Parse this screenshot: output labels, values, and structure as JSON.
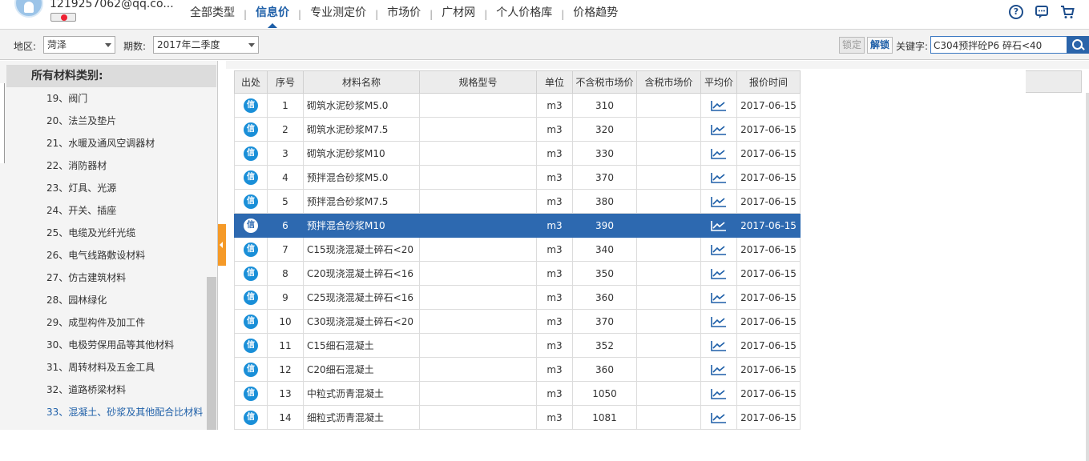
{
  "user": {
    "email": "1219257062@qq.co..."
  },
  "nav": {
    "items": [
      {
        "label": "全部类型"
      },
      {
        "label": "信息价"
      },
      {
        "label": "专业测定价"
      },
      {
        "label": "市场价"
      },
      {
        "label": "广材网"
      },
      {
        "label": "个人价格库"
      },
      {
        "label": "价格趋势"
      }
    ],
    "active_index": 1
  },
  "filters": {
    "region_label": "地区:",
    "region_value": "菏泽",
    "period_label": "期数:",
    "period_value": "2017年二季度",
    "lock_label": "锁定",
    "unlock_label": "解锁",
    "keyword_label": "关键字:",
    "keyword_value": "C304预拌砼P6 碎石<40"
  },
  "sidebar": {
    "title": "所有材料类别:",
    "items": [
      "19、阀门",
      "20、法兰及垫片",
      "21、水暖及通风空调器材",
      "22、消防器材",
      "23、灯具、光源",
      "24、开关、插座",
      "25、电缆及光纤光缆",
      "26、电气线路敷设材料",
      "27、仿古建筑材料",
      "28、园林绿化",
      "29、成型构件及加工件",
      "30、电极劳保用品等其他材料",
      "31、周转材料及五金工具",
      "32、道路桥梁材料",
      "33、混凝土、砂浆及其他配合比材料"
    ],
    "selected_index": 14
  },
  "table": {
    "columns": [
      "出处",
      "序号",
      "材料名称",
      "规格型号",
      "单位",
      "不含税市场价",
      "含税市场价",
      "平均价",
      "报价时间"
    ],
    "source_icon_text": "信",
    "selected_row": 5,
    "rows": [
      {
        "no": "1",
        "name": "砌筑水泥砂浆M5.0",
        "spec": "",
        "unit": "m3",
        "price": "310",
        "price_tax": "",
        "date": "2017-06-15"
      },
      {
        "no": "2",
        "name": "砌筑水泥砂浆M7.5",
        "spec": "",
        "unit": "m3",
        "price": "320",
        "price_tax": "",
        "date": "2017-06-15"
      },
      {
        "no": "3",
        "name": "砌筑水泥砂浆M10",
        "spec": "",
        "unit": "m3",
        "price": "330",
        "price_tax": "",
        "date": "2017-06-15"
      },
      {
        "no": "4",
        "name": "预拌混合砂浆M5.0",
        "spec": "",
        "unit": "m3",
        "price": "370",
        "price_tax": "",
        "date": "2017-06-15"
      },
      {
        "no": "5",
        "name": "预拌混合砂浆M7.5",
        "spec": "",
        "unit": "m3",
        "price": "380",
        "price_tax": "",
        "date": "2017-06-15"
      },
      {
        "no": "6",
        "name": "预拌混合砂浆M10",
        "spec": "",
        "unit": "m3",
        "price": "390",
        "price_tax": "",
        "date": "2017-06-15"
      },
      {
        "no": "7",
        "name": "C15现浇混凝土碎石<20",
        "spec": "",
        "unit": "m3",
        "price": "340",
        "price_tax": "",
        "date": "2017-06-15"
      },
      {
        "no": "8",
        "name": "C20现浇混凝土碎石<16",
        "spec": "",
        "unit": "m3",
        "price": "350",
        "price_tax": "",
        "date": "2017-06-15"
      },
      {
        "no": "9",
        "name": "C25现浇混凝土碎石<16",
        "spec": "",
        "unit": "m3",
        "price": "360",
        "price_tax": "",
        "date": "2017-06-15"
      },
      {
        "no": "10",
        "name": "C30现浇混凝土碎石<20",
        "spec": "",
        "unit": "m3",
        "price": "370",
        "price_tax": "",
        "date": "2017-06-15"
      },
      {
        "no": "11",
        "name": "C15细石混凝土",
        "spec": "",
        "unit": "m3",
        "price": "352",
        "price_tax": "",
        "date": "2017-06-15"
      },
      {
        "no": "12",
        "name": "C20细石混凝土",
        "spec": "",
        "unit": "m3",
        "price": "360",
        "price_tax": "",
        "date": "2017-06-15"
      },
      {
        "no": "13",
        "name": "中粒式沥青混凝土",
        "spec": "",
        "unit": "m3",
        "price": "1050",
        "price_tax": "",
        "date": "2017-06-15"
      },
      {
        "no": "14",
        "name": "细粒式沥青混凝土",
        "spec": "",
        "unit": "m3",
        "price": "1081",
        "price_tax": "",
        "date": "2017-06-15"
      }
    ]
  },
  "colors": {
    "accent": "#1e5fa8",
    "selected_row": "#2d69b0",
    "info_icon": "#1a8fd8",
    "collapse_tab": "#f59a28"
  }
}
